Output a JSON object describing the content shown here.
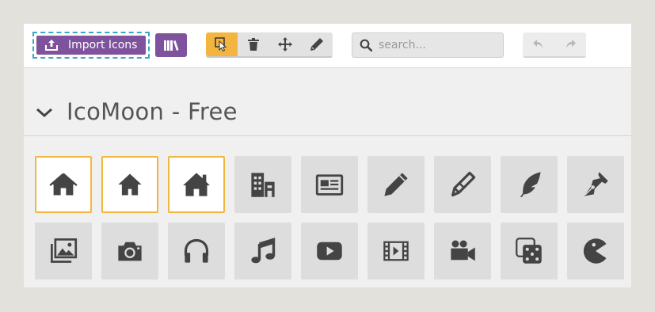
{
  "toolbar": {
    "import_label": "Import Icons",
    "search_placeholder": "search..."
  },
  "set": {
    "title": "IcoMoon - Free"
  },
  "icons": [
    {
      "name": "home-icon",
      "selected": true
    },
    {
      "name": "home2-icon",
      "selected": true
    },
    {
      "name": "home3-icon",
      "selected": true
    },
    {
      "name": "office-icon",
      "selected": false
    },
    {
      "name": "newspaper-icon",
      "selected": false
    },
    {
      "name": "pencil-icon",
      "selected": false
    },
    {
      "name": "pencil2-icon",
      "selected": false
    },
    {
      "name": "quill-icon",
      "selected": false
    },
    {
      "name": "pen-icon",
      "selected": false
    },
    {
      "name": "images-icon",
      "selected": false
    },
    {
      "name": "camera-icon",
      "selected": false
    },
    {
      "name": "headphones-icon",
      "selected": false
    },
    {
      "name": "music-icon",
      "selected": false
    },
    {
      "name": "play-icon",
      "selected": false
    },
    {
      "name": "film-icon",
      "selected": false
    },
    {
      "name": "video-camera-icon",
      "selected": false
    },
    {
      "name": "dice-icon",
      "selected": false
    },
    {
      "name": "pacman-icon",
      "selected": false
    }
  ],
  "colors": {
    "brand": "#7f529e",
    "accent": "#f4b540",
    "focus": "#3aa6c6",
    "icon": "#444444"
  }
}
